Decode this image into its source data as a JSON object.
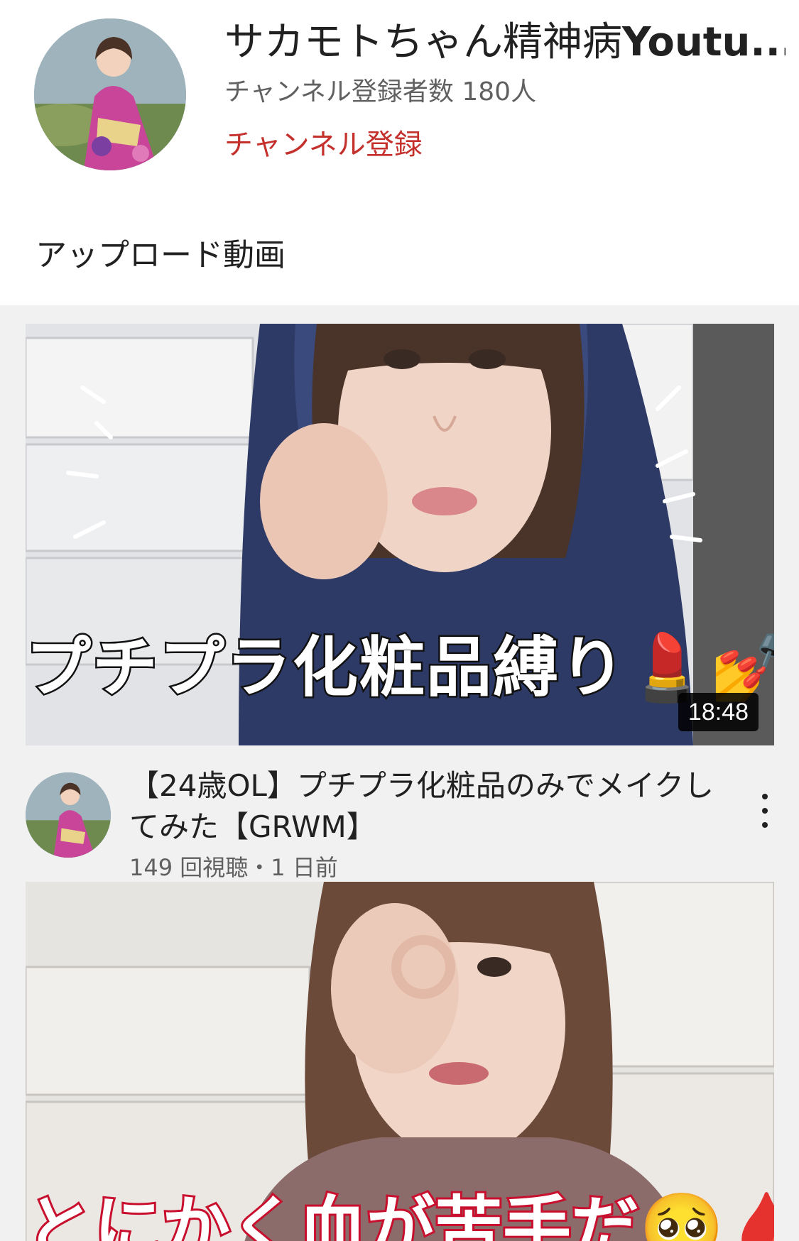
{
  "channel": {
    "name_prefix": "サカモトちゃん精神病",
    "name_suffix": "Youtu...",
    "subscriber_count": "チャンネル登録者数 180人",
    "subscribe_label": "チャンネル登録"
  },
  "section": {
    "heading": "アップロード動画"
  },
  "videos": [
    {
      "thumbnail_caption": "プチプラ化粧品縛り💄💅",
      "duration": "18:48",
      "title": "【24歳OL】プチプラ化粧品のみでメイクしてみた【GRWM】",
      "stats": "149 回視聴・1 日前"
    },
    {
      "thumbnail_caption": "とにかく血が苦手だ🥺🩸"
    }
  ],
  "colors": {
    "subscribe_red": "#c4302b",
    "list_background": "#f1f1f1",
    "secondary_text": "#606060"
  },
  "icons": {
    "more": "more-vert-icon"
  }
}
